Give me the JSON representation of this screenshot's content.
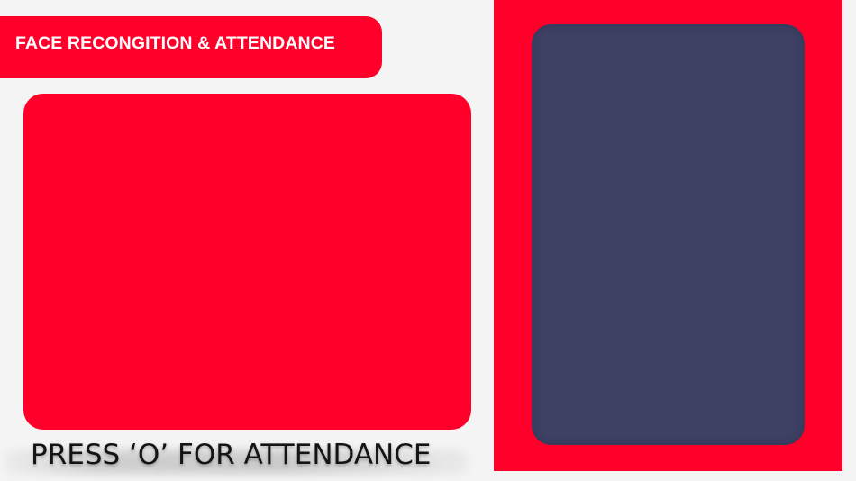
{
  "header": {
    "title": "FACE RECONGITION & ATTENDANCE"
  },
  "instruction": {
    "text": "PRESS ‘O’ FOR ATTENDANCE"
  },
  "colors": {
    "accent": "#ff002b",
    "panel": "#3e4163",
    "background": "#f4f4f4"
  }
}
